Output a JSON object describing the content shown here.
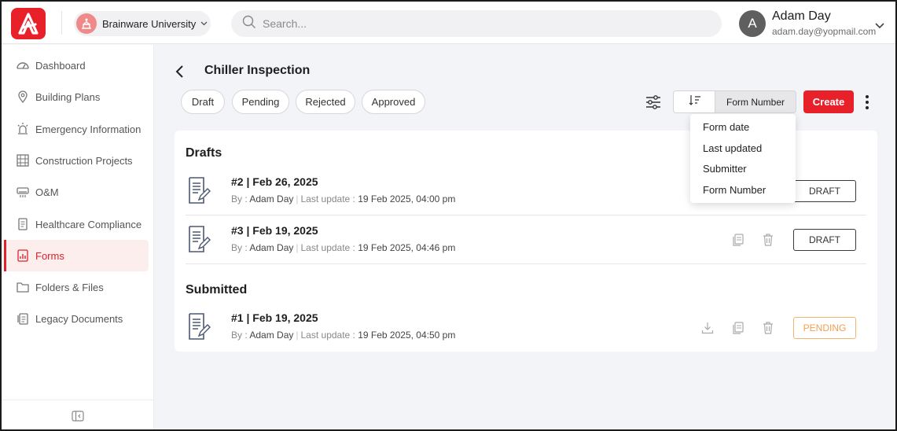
{
  "header": {
    "organization": "Brainware University",
    "search_placeholder": "Search...",
    "user": {
      "initial": "A",
      "name": "Adam Day",
      "email": "adam.day@yopmail.com"
    }
  },
  "sidebar": {
    "items": [
      {
        "label": "Dashboard",
        "icon": "dashboard-icon"
      },
      {
        "label": "Building Plans",
        "icon": "location-pin-icon"
      },
      {
        "label": "Emergency Information",
        "icon": "alarm-icon"
      },
      {
        "label": "Construction Projects",
        "icon": "building-icon"
      },
      {
        "label": "O&M",
        "icon": "air-conditioner-icon"
      },
      {
        "label": "Healthcare Compliance",
        "icon": "clipboard-icon"
      },
      {
        "label": "Forms",
        "icon": "form-chart-icon",
        "active": true
      },
      {
        "label": "Folders & Files",
        "icon": "folder-icon"
      },
      {
        "label": "Legacy Documents",
        "icon": "documents-icon"
      }
    ]
  },
  "page": {
    "title": "Chiller Inspection",
    "filters": [
      "Draft",
      "Pending",
      "Rejected",
      "Approved"
    ],
    "sort_field": "Form Number",
    "create_label": "Create",
    "sort_options": [
      "Form date",
      "Last updated",
      "Submitter",
      "Form Number"
    ]
  },
  "sections": {
    "drafts": {
      "title": "Drafts",
      "rows": [
        {
          "title": "#2 | Feb 26, 2025",
          "by_label": "By :",
          "by": "Adam Day",
          "updated_label": "Last update :",
          "updated": "19 Feb 2025, 04:00 pm",
          "status": "DRAFT"
        },
        {
          "title": "#3 | Feb 19, 2025",
          "by_label": "By :",
          "by": "Adam Day",
          "updated_label": "Last update :",
          "updated": "19 Feb 2025, 04:46 pm",
          "status": "DRAFT"
        }
      ]
    },
    "submitted": {
      "title": "Submitted",
      "rows": [
        {
          "title": "#1 | Feb 19, 2025",
          "by_label": "By :",
          "by": "Adam Day",
          "updated_label": "Last update :",
          "updated": "19 Feb 2025, 04:50 pm",
          "status": "PENDING"
        }
      ]
    }
  },
  "colors": {
    "brand": "#e8202a",
    "pending": "#f0a050",
    "active_bg": "#fdeeee"
  }
}
